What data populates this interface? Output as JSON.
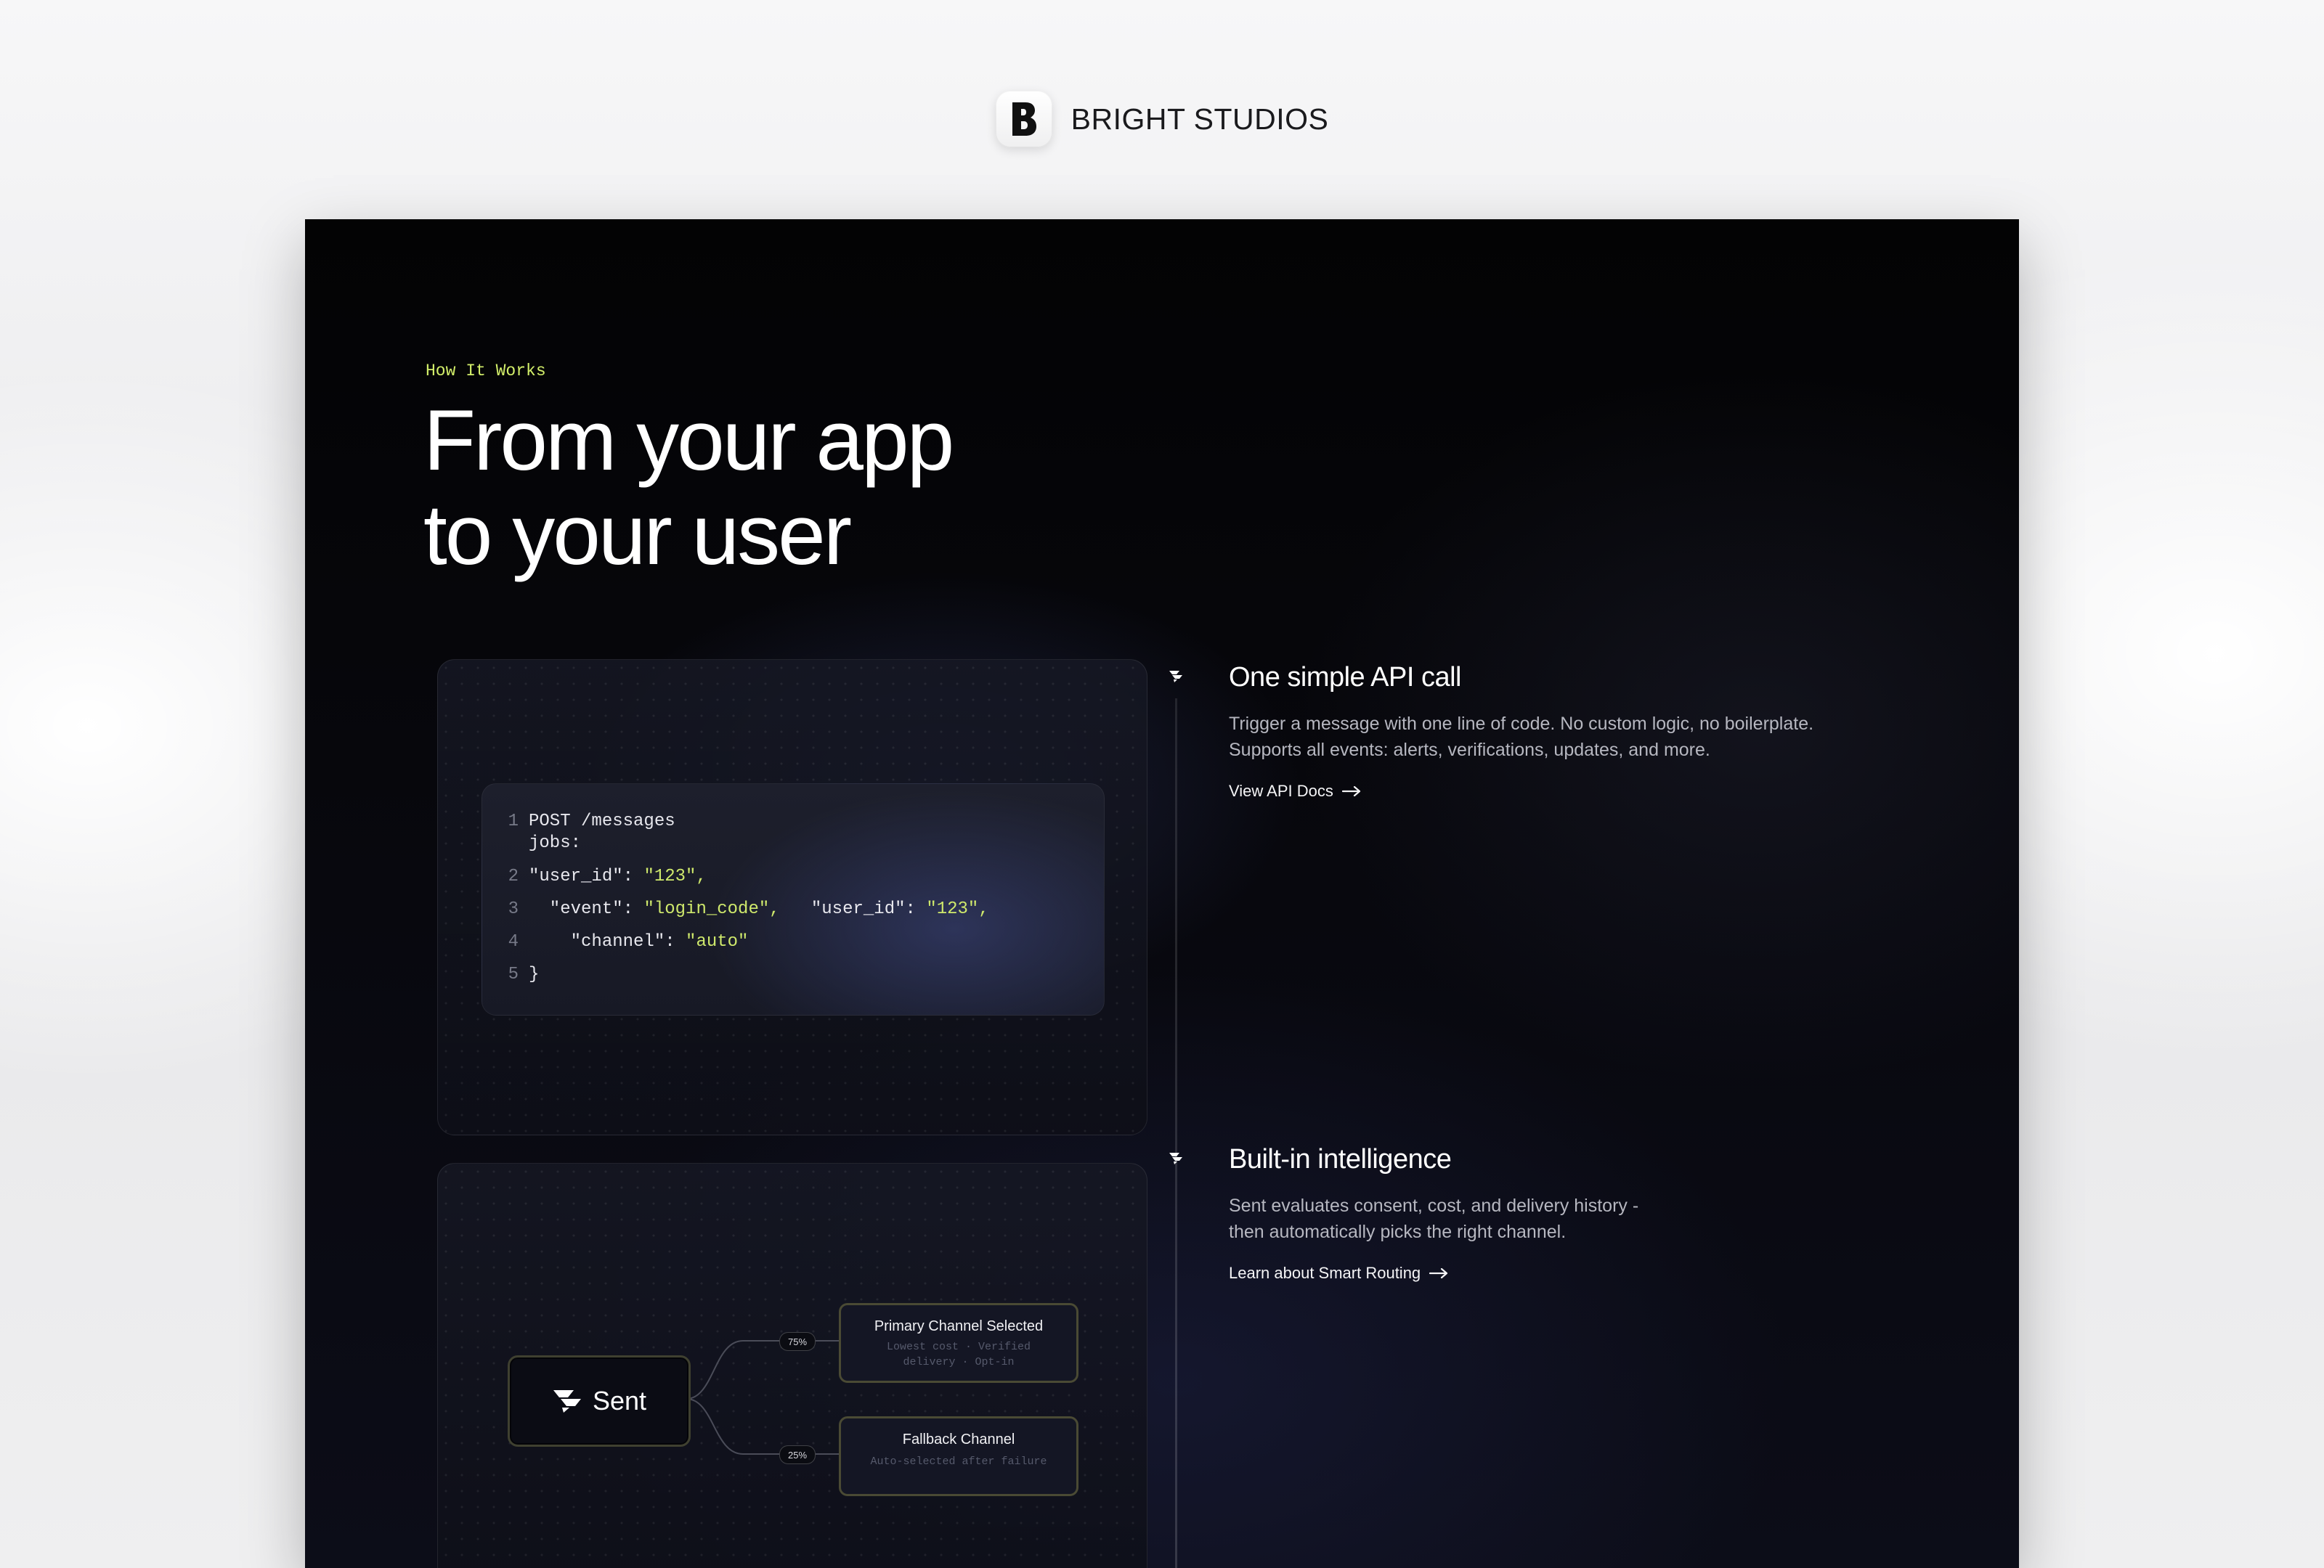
{
  "brand": {
    "name": "BRIGHT STUDIOS",
    "logo_icon": "b-logo-icon"
  },
  "section": {
    "eyebrow": "How It Works",
    "headline_line1": "From your app",
    "headline_line2": "to your user"
  },
  "code_sample": {
    "lines": [
      {
        "num": "1",
        "text": "POST /messages"
      },
      {
        "num": "",
        "text": "jobs:"
      },
      {
        "num": "2",
        "key": "\"user_id\": ",
        "str": "\"123\","
      },
      {
        "num": "3",
        "key": "  \"event\": ",
        "str": "\"login_code\",",
        "key2": "   \"user_id\": ",
        "str2": "\"123\","
      },
      {
        "num": "4",
        "key": "    \"channel\": ",
        "str": "\"auto\""
      },
      {
        "num": "5",
        "text": "}"
      }
    ]
  },
  "routing": {
    "source_label": "Sent",
    "source_icon": "sent-logo-icon",
    "primary": {
      "title": "Primary Channel Selected",
      "subtitle_line1": "Lowest cost · Verified",
      "subtitle_line2": "delivery · Opt-in",
      "share_label": "75%",
      "share": 0.75
    },
    "fallback": {
      "title": "Fallback Channel",
      "subtitle": "Auto-selected after failure",
      "share_label": "25%",
      "share": 0.25
    }
  },
  "steps": [
    {
      "title": "One simple API call",
      "desc_line1": "Trigger a message with one line of code. No custom logic, no boilerplate.",
      "desc_line2": "Supports all events: alerts, verifications, updates, and more.",
      "link": "View API Docs",
      "link_icon": "arrow-right-icon",
      "marker_icon": "sent-logo-icon"
    },
    {
      "title": "Built-in intelligence",
      "desc_line1": "Sent evaluates consent, cost, and delivery history -",
      "desc_line2": "then automatically picks the right channel.",
      "link": "Learn about Smart Routing",
      "link_icon": "arrow-right-icon",
      "marker_icon": "sent-logo-icon"
    }
  ],
  "colors": {
    "accent": "#d3ef6a",
    "card_bg": "#05050a",
    "text": "#ffffff",
    "muted": "#b6b7c0"
  }
}
